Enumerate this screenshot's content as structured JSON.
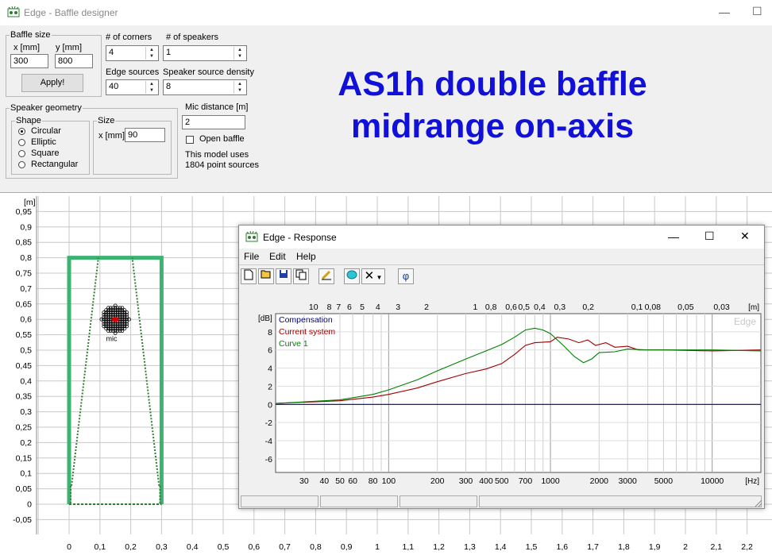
{
  "main_window": {
    "title": "Edge - Baffle designer",
    "minimize": "—",
    "maximize": "☐"
  },
  "baffle_size": {
    "legend": "Baffle size",
    "x_label": "x [mm]",
    "y_label": "y [mm]",
    "x_value": "300",
    "y_value": "800",
    "apply_label": "Apply!"
  },
  "corners": {
    "label": "# of corners",
    "value": "4"
  },
  "speakers": {
    "label": "# of speakers",
    "value": "1"
  },
  "edge_sources": {
    "label": "Edge sources",
    "value": "40"
  },
  "speaker_density": {
    "label": "Speaker source density",
    "value": "8"
  },
  "mic": {
    "label": "Mic distance [m]",
    "value": "2",
    "open_baffle_label": "Open baffle",
    "open_baffle_checked": false,
    "info_line1": "This model uses",
    "info_line2": "1804 point sources"
  },
  "geometry": {
    "legend": "Speaker geometry",
    "shape_legend": "Shape",
    "shapes": [
      {
        "label": "Circular",
        "selected": true
      },
      {
        "label": "Elliptic",
        "selected": false
      },
      {
        "label": "Square",
        "selected": false
      },
      {
        "label": "Rectangular",
        "selected": false
      }
    ],
    "size_legend": "Size",
    "size_label": "x [mm]",
    "size_value": "90"
  },
  "headline": {
    "line1": "AS1h double baffle",
    "line2": "midrange on-axis"
  },
  "baffle_plot": {
    "unit_label": "[m]",
    "mic_label": "mic",
    "y_ticks": [
      "0,95",
      "0,9",
      "0,85",
      "0,8",
      "0,75",
      "0,7",
      "0,65",
      "0,6",
      "0,55",
      "0,5",
      "0,45",
      "0,4",
      "0,35",
      "0,3",
      "0,25",
      "0,2",
      "0,15",
      "0,1",
      "0,05",
      "0",
      "-0,05"
    ],
    "x_ticks": [
      "0",
      "0,1",
      "0,2",
      "0,3",
      "0,4",
      "0,5",
      "0,6",
      "0,7",
      "0,8",
      "0,9",
      "1",
      "1,1",
      "1,2",
      "1,3",
      "1,4",
      "1,5",
      "1,6",
      "1,7",
      "1,8",
      "1,9",
      "2",
      "2,1",
      "2,2"
    ],
    "colors": {
      "baffle": "#3cb371",
      "edge": "#2e7d32",
      "speaker": "#000000",
      "mic": "#d00000"
    }
  },
  "response_window": {
    "title": "Edge - Response",
    "minimize": "—",
    "maximize": "☐",
    "close": "✕",
    "menu": [
      "File",
      "Edit",
      "Help"
    ],
    "phi_label": "φ",
    "watermark": "Edge"
  },
  "chart_data": {
    "type": "line",
    "xscale": "log",
    "xlim": [
      20,
      20000
    ],
    "ylim": [
      -7.5,
      10
    ],
    "ylabel": "[dB]",
    "xlabel": "[Hz]",
    "top_axis_label": "[m]",
    "y_ticks": [
      8,
      6,
      4,
      2,
      0,
      -2,
      -4,
      -6
    ],
    "x_ticks": [
      {
        "v": 30,
        "l": "30"
      },
      {
        "v": 40,
        "l": "40"
      },
      {
        "v": 50,
        "l": "50"
      },
      {
        "v": 60,
        "l": "60"
      },
      {
        "v": 80,
        "l": "80"
      },
      {
        "v": 100,
        "l": "100"
      },
      {
        "v": 200,
        "l": "200"
      },
      {
        "v": 300,
        "l": "300"
      },
      {
        "v": 400,
        "l": "400"
      },
      {
        "v": 500,
        "l": "500"
      },
      {
        "v": 700,
        "l": "700"
      },
      {
        "v": 1000,
        "l": "1000"
      },
      {
        "v": 2000,
        "l": "2000"
      },
      {
        "v": 3000,
        "l": "3000"
      },
      {
        "v": 5000,
        "l": "5000"
      },
      {
        "v": 10000,
        "l": "10000"
      }
    ],
    "top_ticks": [
      {
        "v": 34.3,
        "l": "10"
      },
      {
        "v": 42.9,
        "l": "8"
      },
      {
        "v": 49,
        "l": "7"
      },
      {
        "v": 57.2,
        "l": "6"
      },
      {
        "v": 68.6,
        "l": "5"
      },
      {
        "v": 85.8,
        "l": "4"
      },
      {
        "v": 114.3,
        "l": "3"
      },
      {
        "v": 171.5,
        "l": "2"
      },
      {
        "v": 343,
        "l": "1"
      },
      {
        "v": 428.8,
        "l": "0,8"
      },
      {
        "v": 571.7,
        "l": "0,6"
      },
      {
        "v": 686,
        "l": "0,5"
      },
      {
        "v": 857.5,
        "l": "0,4"
      },
      {
        "v": 1143,
        "l": "0,3"
      },
      {
        "v": 1715,
        "l": "0,2"
      },
      {
        "v": 3430,
        "l": "0,1"
      },
      {
        "v": 4288,
        "l": "0,08"
      },
      {
        "v": 6860,
        "l": "0,05"
      },
      {
        "v": 11433,
        "l": "0,03"
      }
    ],
    "series": [
      {
        "name": "Compensation",
        "color": "#000080",
        "points": [
          [
            20,
            0
          ],
          [
            20000,
            0
          ]
        ]
      },
      {
        "name": "Current system",
        "color": "#a00000",
        "points": [
          [
            20,
            0.1
          ],
          [
            50,
            0.4
          ],
          [
            80,
            0.8
          ],
          [
            100,
            1.1
          ],
          [
            150,
            1.8
          ],
          [
            200,
            2.5
          ],
          [
            300,
            3.4
          ],
          [
            400,
            3.9
          ],
          [
            500,
            4.5
          ],
          [
            600,
            5.5
          ],
          [
            700,
            6.5
          ],
          [
            800,
            6.8
          ],
          [
            1000,
            6.9
          ],
          [
            1100,
            7.4
          ],
          [
            1300,
            7.2
          ],
          [
            1500,
            6.8
          ],
          [
            1700,
            7.1
          ],
          [
            1900,
            6.5
          ],
          [
            2200,
            6.8
          ],
          [
            2500,
            6.3
          ],
          [
            3000,
            6.4
          ],
          [
            3500,
            6.0
          ],
          [
            5000,
            6.0
          ],
          [
            10000,
            5.9
          ],
          [
            20000,
            6.0
          ]
        ]
      },
      {
        "name": "Curve 1",
        "color": "#008000",
        "points": [
          [
            20,
            0.1
          ],
          [
            50,
            0.5
          ],
          [
            80,
            1.1
          ],
          [
            100,
            1.6
          ],
          [
            150,
            2.7
          ],
          [
            200,
            3.7
          ],
          [
            300,
            5.0
          ],
          [
            400,
            5.9
          ],
          [
            500,
            6.6
          ],
          [
            600,
            7.4
          ],
          [
            700,
            8.2
          ],
          [
            800,
            8.4
          ],
          [
            900,
            8.2
          ],
          [
            1000,
            7.8
          ],
          [
            1200,
            6.5
          ],
          [
            1400,
            5.3
          ],
          [
            1600,
            4.6
          ],
          [
            1800,
            5.0
          ],
          [
            2000,
            5.7
          ],
          [
            2500,
            5.8
          ],
          [
            3000,
            6.1
          ],
          [
            4000,
            6.0
          ],
          [
            6000,
            6.0
          ],
          [
            10000,
            6.0
          ],
          [
            20000,
            5.9
          ]
        ]
      }
    ]
  }
}
